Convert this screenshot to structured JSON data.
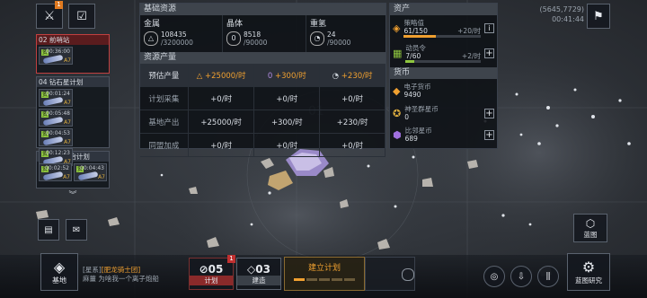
{
  "coords": {
    "position": "(5645,7729)",
    "time": "00:41:44"
  },
  "top_left": {
    "badge": "1"
  },
  "sidebar": {
    "groups": [
      {
        "title": "02 前哨站",
        "fleets": [
          {
            "icon": "资",
            "time": "00:36:00",
            "rank": "A7"
          }
        ]
      },
      {
        "title": "04 钻石星计划",
        "fleets": [
          {
            "icon": "资",
            "time": "00:01:24",
            "rank": "A7"
          },
          {
            "icon": "资",
            "time": "00:05:48",
            "rank": "A7"
          },
          {
            "icon": "资",
            "time": "00:04:53",
            "rank": "A7"
          },
          {
            "icon": "资",
            "time": "00:12:23",
            "rank": "A7"
          }
        ]
      },
      {
        "title": "01 无为而治计划",
        "fleets": [
          {
            "icon": "资",
            "time": "00:02:52",
            "rank": "A7"
          },
          {
            "icon": "资",
            "time": "00:04:43",
            "rank": "A7"
          }
        ]
      }
    ]
  },
  "basic_resources": {
    "title": "基础资源",
    "metal": {
      "label": "金属",
      "value": "108435",
      "cap": "/3200000"
    },
    "crystal": {
      "label": "晶体",
      "value": "8518",
      "cap": "/90000"
    },
    "deuterium": {
      "label": "重氢",
      "value": "24",
      "cap": "/90000"
    }
  },
  "production": {
    "title": "资源产量",
    "header": {
      "label": "预估产量",
      "metal": "+25000/时",
      "crystal": "+300/时",
      "deut": "+230/时"
    },
    "rows": [
      {
        "label": "计划采集",
        "metal": "+0/时",
        "crystal": "+0/时",
        "deut": "+0/时"
      },
      {
        "label": "基地产出",
        "metal": "+25000/时",
        "crystal": "+300/时",
        "deut": "+230/时"
      },
      {
        "label": "同盟加成",
        "metal": "+0/时",
        "crystal": "+0/时",
        "deut": "+0/时"
      }
    ]
  },
  "assets": {
    "title": "资产",
    "strategy": {
      "label": "策略值",
      "value": "61/150",
      "rate": "+20/时",
      "fill": 0.41
    },
    "mobilize": {
      "label": "动员令",
      "value": "7/60",
      "rate": "+2/时",
      "fill": 0.12
    }
  },
  "currency": {
    "title": "货币",
    "items": [
      {
        "label": "电子货币",
        "value": "9490"
      },
      {
        "label": "神圣群星币",
        "value": "0"
      },
      {
        "label": "比邻星币",
        "value": "689"
      }
    ]
  },
  "chat": {
    "channel": "[星系]",
    "name": "[肥龙骑士团]",
    "text": "麻薑 为啥我一个离子炮船"
  },
  "bottom": {
    "base_label": "基地",
    "plan_count": "05",
    "plan_label": "计划",
    "plan_badge": "1",
    "build_count": "03",
    "build_label": "建造",
    "build_plan_label": "建立计划",
    "blueprint_label": "蓝图",
    "blueprint_research_label": "蓝图研究"
  },
  "map_labels": {
    "sector": "01"
  }
}
